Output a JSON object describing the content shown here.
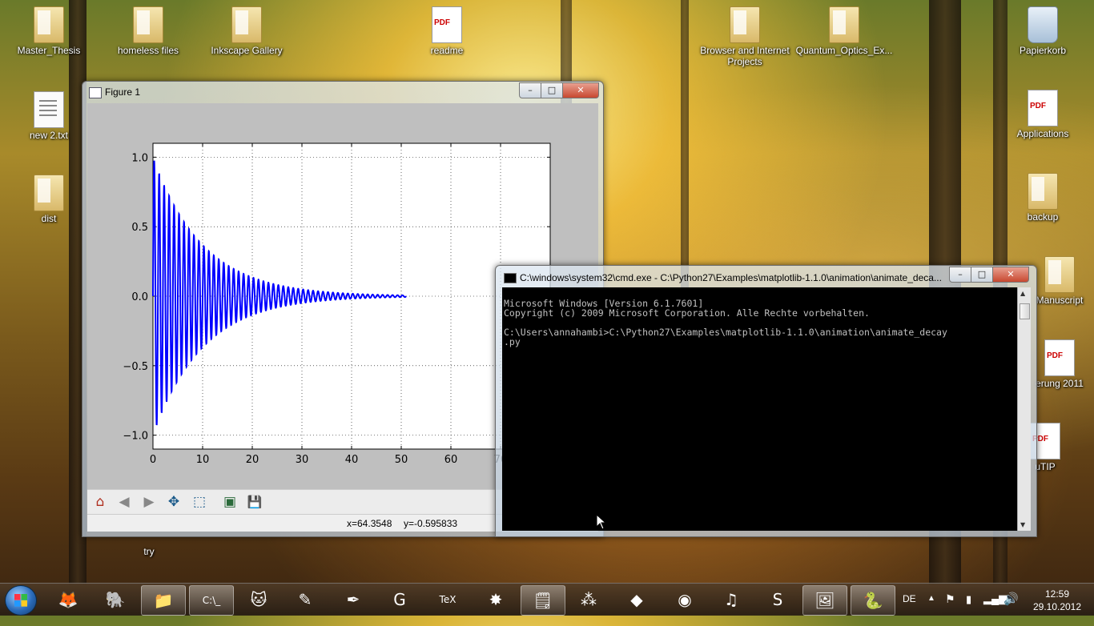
{
  "desktop": {
    "icons_left": [
      {
        "label": "Master_Thesis",
        "kind": "folder"
      },
      {
        "label": "homeless files",
        "kind": "folder"
      },
      {
        "label": "Inkscape Gallery",
        "kind": "folder"
      },
      {
        "label": "readme",
        "kind": "pdf"
      },
      {
        "label": "new 2.txt",
        "kind": "doc"
      },
      {
        "label": "dist",
        "kind": "folder"
      },
      {
        "label": "try",
        "kind": "folder"
      }
    ],
    "icons_right": [
      {
        "label": "Browser and Internet Projects",
        "kind": "folder"
      },
      {
        "label": "Quantum_Optics_Ex...",
        "kind": "folder"
      },
      {
        "label": "Papierkorb",
        "kind": "bin"
      },
      {
        "label": "Applications",
        "kind": "pdf"
      },
      {
        "label": "backup",
        "kind": "folder"
      },
      {
        "label": "Manuscript",
        "kind": "folder"
      },
      {
        "label": "erung 2011",
        "kind": "pdf"
      },
      {
        "label": "uTIP",
        "kind": "pdf"
      }
    ]
  },
  "figure_window": {
    "title": "Figure 1",
    "controls": {
      "minimize": "–",
      "maximize": "□",
      "close": "✕"
    },
    "toolbar": [
      {
        "name": "home-icon",
        "glyph": "⌂"
      },
      {
        "name": "back-icon",
        "glyph": "◀"
      },
      {
        "name": "forward-icon",
        "glyph": "▶"
      },
      {
        "name": "pan-icon",
        "glyph": "✥"
      },
      {
        "name": "zoom-icon",
        "glyph": "⬚"
      },
      {
        "name": "subplots-icon",
        "glyph": "▣"
      },
      {
        "name": "save-icon",
        "glyph": "💾"
      }
    ],
    "status": {
      "x": "x=64.3548",
      "y": "y=-0.595833"
    }
  },
  "chart_data": {
    "type": "line",
    "title": "",
    "xlabel": "",
    "ylabel": "",
    "xlim": [
      0,
      80
    ],
    "ylim": [
      -1.1,
      1.1
    ],
    "xticks": [
      "0",
      "10",
      "20",
      "30",
      "40",
      "50",
      "60",
      "70"
    ],
    "yticks": [
      "1.0",
      "0.5",
      "0.0",
      "−0.5",
      "−1.0"
    ],
    "grid": true,
    "series": [
      {
        "color": "#0000ff",
        "description_of_function": "damped sine: y = sin(2*pi*t) * exp(-t/10)",
        "x_range": [
          0,
          51
        ],
        "envelope_samples": {
          "t": [
            0,
            10,
            20,
            30,
            40,
            50
          ],
          "amplitude": [
            1.0,
            0.37,
            0.14,
            0.05,
            0.02,
            0.007
          ]
        }
      }
    ]
  },
  "cmd_window": {
    "title": "C:\\windows\\system32\\cmd.exe - C:\\Python27\\Examples\\matplotlib-1.1.0\\animation\\animate_deca...",
    "controls": {
      "minimize": "–",
      "maximize": "□",
      "close": "✕"
    },
    "lines": [
      "Microsoft Windows [Version 6.1.7601]",
      "Copyright (c) 2009 Microsoft Corporation. Alle Rechte vorbehalten.",
      "",
      "C:\\Users\\annahambi>C:\\Python27\\Examples\\matplotlib-1.1.0\\animation\\animate_decay",
      ".py"
    ]
  },
  "taskbar": {
    "apps": [
      {
        "name": "firefox-icon",
        "glyph": "🦊"
      },
      {
        "name": "evernote-icon",
        "glyph": "🐘"
      },
      {
        "name": "explorer-icon",
        "glyph": "📁"
      },
      {
        "name": "cmd-icon",
        "glyph": "C:\\_"
      },
      {
        "name": "cat-app-icon",
        "glyph": "🐱"
      },
      {
        "name": "texmaker-icon",
        "glyph": "✎"
      },
      {
        "name": "inkscape-icon",
        "glyph": "✒"
      },
      {
        "name": "gnuplot-icon",
        "glyph": "G"
      },
      {
        "name": "tex-icon",
        "glyph": "TeX"
      },
      {
        "name": "red-star-icon",
        "glyph": "✸"
      },
      {
        "name": "notes-icon",
        "glyph": "🗒"
      },
      {
        "name": "mendeley-icon",
        "glyph": "⁂"
      },
      {
        "name": "colorful-app-icon",
        "glyph": "◆"
      },
      {
        "name": "picasa-icon",
        "glyph": "◉"
      },
      {
        "name": "spotify-icon",
        "glyph": "♫"
      },
      {
        "name": "skype-icon",
        "glyph": "S"
      },
      {
        "name": "image-viewer-icon",
        "glyph": "🖼"
      },
      {
        "name": "python-icon",
        "glyph": "🐍"
      }
    ],
    "language": "DE",
    "time": "12:59",
    "date": "29.10.2012"
  }
}
